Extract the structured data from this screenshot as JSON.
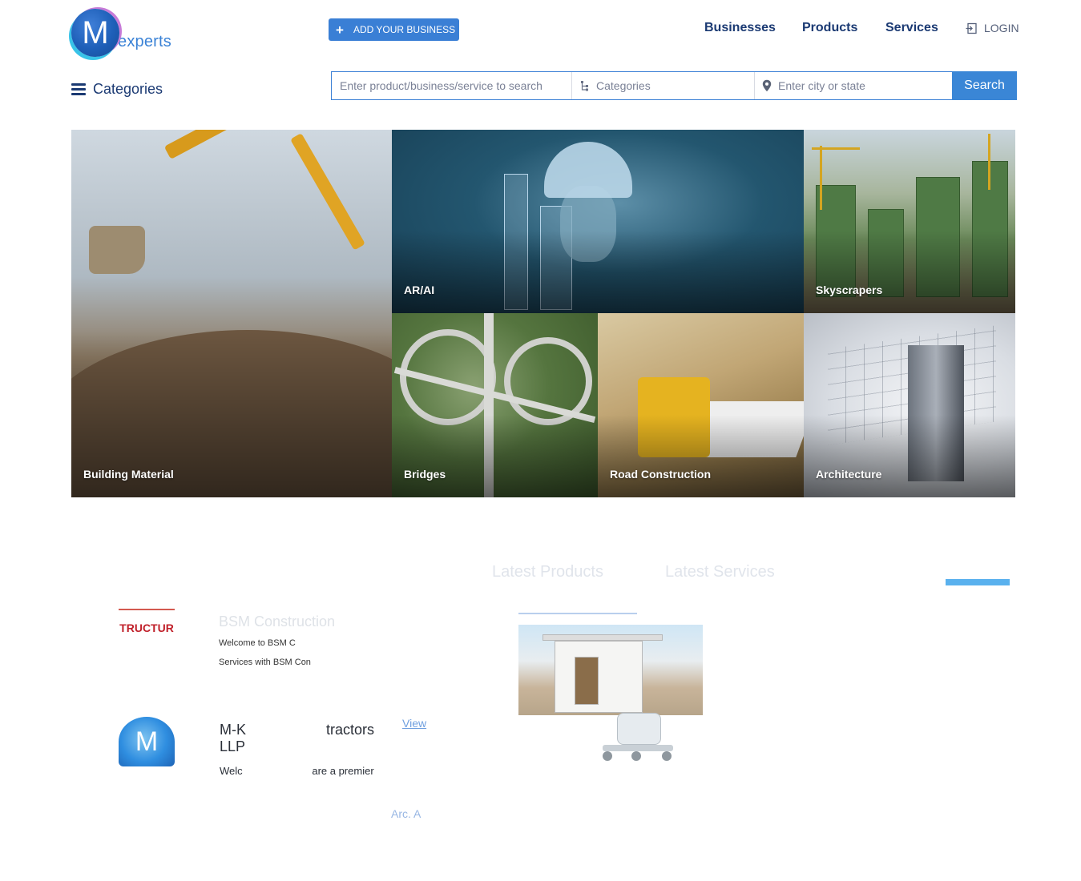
{
  "header": {
    "logo_letter": "M",
    "logo_text": "experts",
    "add_business_label": "ADD YOUR BUSINESS",
    "nav": [
      {
        "label": "Businesses"
      },
      {
        "label": "Products"
      },
      {
        "label": "Services"
      }
    ],
    "login_label": "LOGIN",
    "categories_label": "Categories"
  },
  "search": {
    "query_placeholder": "Enter product/business/service to search",
    "category_placeholder": "Categories",
    "location_placeholder": "Enter city or state",
    "button_label": "Search"
  },
  "tiles": [
    {
      "label": "Building Material"
    },
    {
      "label": "AR/AI"
    },
    {
      "label": "Skyscrapers"
    },
    {
      "label": "Bridges"
    },
    {
      "label": "Road Construction"
    },
    {
      "label": "Architecture"
    }
  ],
  "lower": {
    "tabs": [
      {
        "label": "Latest Products"
      },
      {
        "label": "Latest Services"
      }
    ],
    "listings": [
      {
        "name": "BSM Construction",
        "logo_text": "TRUCTUR",
        "lines": [
          "Welcome to BSM C",
          "Services with BSM Con"
        ]
      },
      {
        "name": "M-K                    tractors",
        "name_line2": "LLP",
        "logo_text": "M",
        "description": "Welc                        are a premier",
        "view_label": "View"
      }
    ],
    "footer_link": "Arc. A"
  },
  "colors": {
    "primary": "#3a7fd5",
    "nav_text": "#1b3a73",
    "accent_tab": "#5ab1ee"
  },
  "icons": {
    "add": "plus-icon",
    "login": "login-icon",
    "categories": "hamburger-icon",
    "category_field": "tree-icon",
    "location_field": "map-pin-icon"
  }
}
